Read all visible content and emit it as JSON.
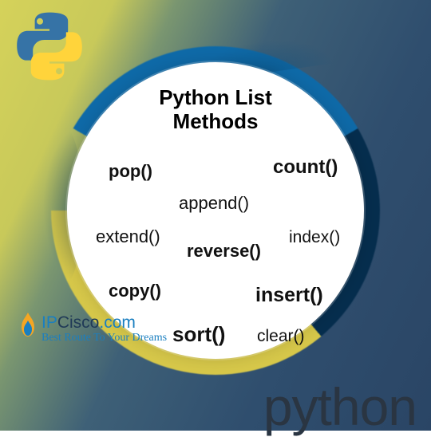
{
  "title_line1": "Python List",
  "title_line2": "Methods",
  "methods": {
    "pop": "pop()",
    "count": "count()",
    "append": "append()",
    "extend": "extend()",
    "reverse": "reverse()",
    "index": "index()",
    "copy": "copy()",
    "insert": "insert()",
    "sort": "sort()",
    "clear": "clear()"
  },
  "ipcisco": {
    "ip": "IP",
    "cisco": "Cisco",
    "com": ".com",
    "tagline": "Best Route To Your Dreams"
  },
  "footer_python": "python"
}
